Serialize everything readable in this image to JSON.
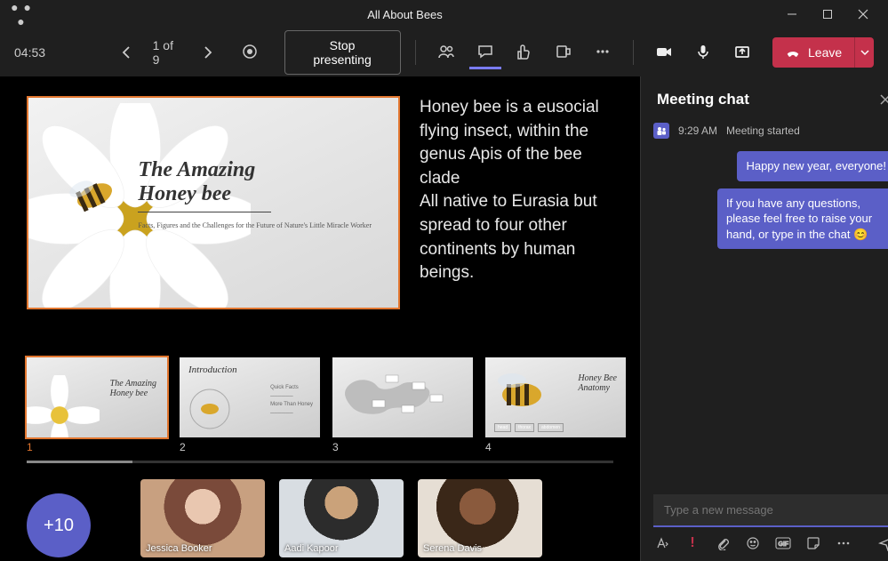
{
  "window": {
    "title": "All About Bees"
  },
  "toolbar": {
    "timer": "04:53",
    "slide_counter": "1 of 9",
    "stop_label": "Stop presenting",
    "leave_label": "Leave"
  },
  "slide": {
    "title_line1": "The Amazing",
    "title_line2": "Honey bee",
    "subtitle": "Facts, Figures and the Challenges for the Future of Nature's Little Miracle Worker"
  },
  "notes": {
    "para1": "Honey bee is a eusocial flying insect, within the genus Apis of the bee clade",
    "para2": "All native to Eurasia but spread to four other continents by human beings."
  },
  "thumbs": [
    {
      "num": "1",
      "title_a": "The Amazing",
      "title_b": "Honey bee",
      "selected": true
    },
    {
      "num": "2",
      "heading": "Introduction",
      "selected": false
    },
    {
      "num": "3",
      "heading": "",
      "selected": false
    },
    {
      "num": "4",
      "title_a": "Honey Bee",
      "title_b": "Anatomy",
      "selected": false
    }
  ],
  "participants": {
    "overflow": "+10",
    "people": [
      {
        "name": "Jessica Booker"
      },
      {
        "name": "Aadi Kapoor"
      },
      {
        "name": "Serena Davis"
      }
    ]
  },
  "chat": {
    "title": "Meeting chat",
    "system_time": "9:29 AM",
    "system_text": "Meeting started",
    "messages": [
      "Happy new year, everyone!",
      "If you have any questions, please feel free to raise your hand, or type in the chat 😊"
    ],
    "compose_placeholder": "Type a new message"
  }
}
